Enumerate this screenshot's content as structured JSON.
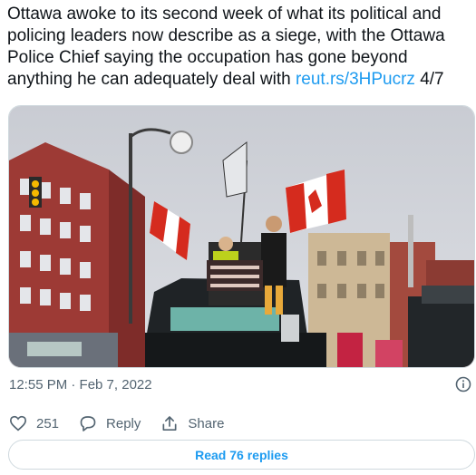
{
  "tweet": {
    "text_part1": "Ottawa awoke to its second week of what its political and policing leaders now describe as a siege, with the Ottawa Police Chief saying the occupation has gone beyond anything he can adequately deal with ",
    "link_text": "reut.rs/3HPucrz",
    "text_part2": " 4/7",
    "timestamp": "12:55 PM · Feb 7, 2022"
  },
  "media": {
    "alt": "Protesters waving Canadian flags on top of a truck in downtown Ottawa"
  },
  "actions": {
    "like_icon": "heart-icon",
    "like_count": "251",
    "reply_icon": "reply-bubble-icon",
    "reply_label": "Reply",
    "share_icon": "share-icon",
    "share_label": "Share"
  },
  "read_replies_label": "Read 76 replies",
  "colors": {
    "link": "#1d9bf0",
    "text": "#0f1419",
    "secondary": "#536471",
    "border": "#cfd9de"
  }
}
